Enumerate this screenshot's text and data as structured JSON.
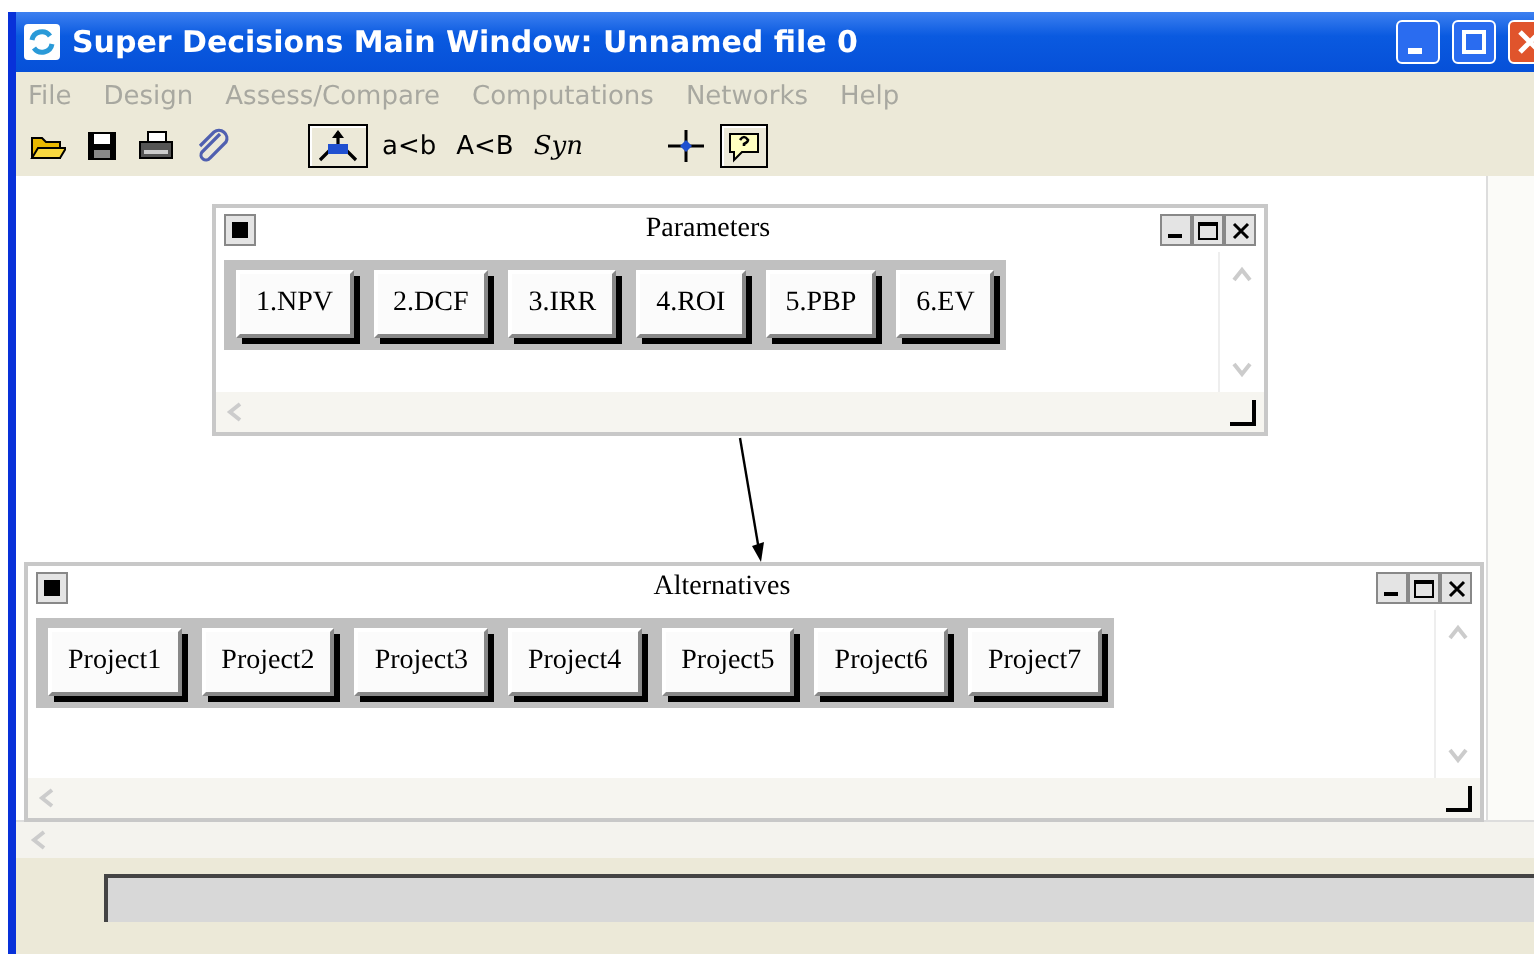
{
  "window": {
    "title": "Super Decisions Main Window: Unnamed file 0"
  },
  "menu": [
    {
      "label": "File",
      "disabled": true
    },
    {
      "label": "Design",
      "disabled": true
    },
    {
      "label": "Assess/Compare",
      "disabled": true
    },
    {
      "label": "Computations",
      "disabled": true
    },
    {
      "label": "Networks",
      "disabled": true
    },
    {
      "label": "Help",
      "disabled": true
    }
  ],
  "toolbar": {
    "hierarchy_pressed": true,
    "help_pressed": true,
    "compare_tools": [
      {
        "label": "a<b",
        "italic": false
      },
      {
        "label": "A<B",
        "italic": false
      },
      {
        "label": "Syn",
        "italic": true
      }
    ]
  },
  "clusters": [
    {
      "title": "Parameters",
      "nodes": [
        {
          "label": "1.NPV"
        },
        {
          "label": "2.DCF"
        },
        {
          "label": "3.IRR"
        },
        {
          "label": "4.ROI"
        },
        {
          "label": "5.PBP"
        },
        {
          "label": "6.EV"
        }
      ]
    },
    {
      "title": "Alternatives",
      "nodes": [
        {
          "label": "Project1"
        },
        {
          "label": "Project2"
        },
        {
          "label": "Project3"
        },
        {
          "label": "Project4"
        },
        {
          "label": "Project5"
        },
        {
          "label": "Project6"
        },
        {
          "label": "Project7"
        }
      ]
    }
  ]
}
